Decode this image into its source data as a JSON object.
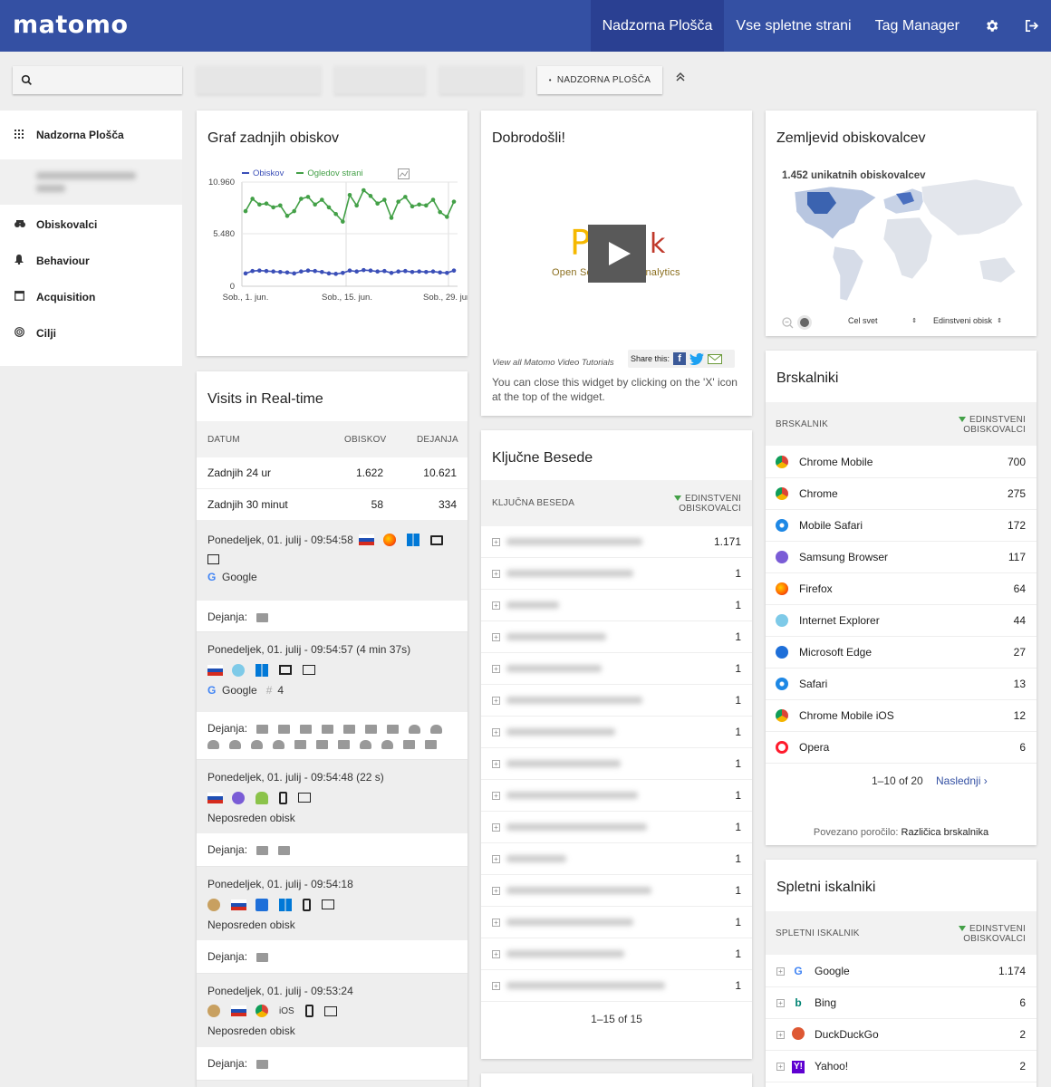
{
  "app": {
    "logo": "matomo"
  },
  "topnav": {
    "dashboard": "Nadzorna Plošča",
    "all_sites": "Vse spletne strani",
    "tag_manager": "Tag Manager"
  },
  "toolbar": {
    "dashboard_button": "NADZORNA PLOŠČA"
  },
  "sidebar": {
    "items": [
      {
        "label": "Nadzorna Plošča",
        "icon": "grid-icon"
      },
      {
        "label": "Obiskovalci",
        "icon": "binoculars-icon"
      },
      {
        "label": "Behaviour",
        "icon": "bell-icon"
      },
      {
        "label": "Acquisition",
        "icon": "window-icon"
      },
      {
        "label": "Cilji",
        "icon": "target-icon"
      }
    ]
  },
  "graph": {
    "title": "Graf zadnjih obiskov",
    "legend": [
      "Obiskov",
      "Ogledov strani"
    ],
    "colors": {
      "visits": "#3b4fb8",
      "pageviews": "#43a047"
    },
    "y_ticks": [
      "10.960",
      "5.480",
      "0"
    ],
    "x_ticks": [
      "Sob., 1. jun.",
      "Sob., 15. jun.",
      "Sob., 29. jun."
    ]
  },
  "chart_data": {
    "type": "line",
    "title": "Graf zadnjih obiskov",
    "ylim": [
      0,
      10960
    ],
    "x": [
      1,
      2,
      3,
      4,
      5,
      6,
      7,
      8,
      9,
      10,
      11,
      12,
      13,
      14,
      15,
      16,
      17,
      18,
      19,
      20,
      21,
      22,
      23,
      24,
      25,
      26,
      27,
      28,
      29,
      30,
      31
    ],
    "series": [
      {
        "name": "Ogledov strani",
        "values": [
          7900,
          9200,
          8600,
          8700,
          8300,
          8500,
          7400,
          7900,
          9200,
          9400,
          8600,
          9100,
          8300,
          7600,
          6800,
          9600,
          8500,
          10100,
          9500,
          8700,
          9100,
          7200,
          8900,
          9400,
          8400,
          8600,
          8500,
          9100,
          7800,
          7300,
          8900
        ]
      },
      {
        "name": "Obiskov",
        "values": [
          1350,
          1600,
          1650,
          1600,
          1550,
          1500,
          1450,
          1350,
          1550,
          1650,
          1600,
          1500,
          1350,
          1300,
          1400,
          1650,
          1550,
          1700,
          1650,
          1550,
          1600,
          1400,
          1550,
          1600,
          1500,
          1550,
          1500,
          1550,
          1450,
          1400,
          1650
        ]
      }
    ]
  },
  "welcome": {
    "title": "Dobrodošli!",
    "video_text": "Open Source Web Analytics",
    "tutorials": "View all Matomo Video Tutorials",
    "share": "Share this:",
    "note": "You can close this widget by clicking on the 'X' icon at the top of the widget."
  },
  "map": {
    "title": "Zemljevid obiskovalcev",
    "summary": "1.452 unikatnih obiskovalcev",
    "region": "Cel svet",
    "metric": "Edinstveni obisk"
  },
  "realtime": {
    "title": "Visits in Real-time",
    "headers": [
      "DATUM",
      "OBISKOV",
      "DEJANJA"
    ],
    "rows": [
      {
        "label": "Zadnjih 24 ur",
        "visits": "1.622",
        "actions": "10.621"
      },
      {
        "label": "Zadnjih 30 minut",
        "visits": "58",
        "actions": "334"
      }
    ],
    "visits": [
      {
        "time": "Ponedeljek, 01. julij - 09:54:58",
        "ref": "Google",
        "actions_label": "Dejanja:"
      },
      {
        "time": "Ponedeljek, 01. julij - 09:54:57 (4 min 37s)",
        "ref": "Google",
        "kw": "4",
        "actions_label": "Dejanja:"
      },
      {
        "time": "Ponedeljek, 01. julij - 09:54:48 (22 s)",
        "ref": "Neposreden obisk",
        "actions_label": "Dejanja:"
      },
      {
        "time": "Ponedeljek, 01. julij - 09:54:18",
        "ref": "Neposreden obisk",
        "actions_label": "Dejanja:"
      },
      {
        "time": "Ponedeljek, 01. julij - 09:53:24",
        "ref": "Neposreden obisk",
        "os": "iOS",
        "actions_label": "Dejanja:"
      }
    ]
  },
  "keywords": {
    "title": "Ključne Besede",
    "col_keyword": "KLJUČNA BESEDA",
    "col_metric_1": "EDINSTVENI",
    "col_metric_2": "OBISKOVALCI",
    "values": [
      "1.171",
      "1",
      "1",
      "1",
      "1",
      "1",
      "1",
      "1",
      "1",
      "1",
      "1",
      "1",
      "1",
      "1",
      "1"
    ],
    "pagination": "1–15 of 15"
  },
  "browsers": {
    "title": "Brskalniki",
    "col_name": "BRSKALNIK",
    "col_metric_1": "EDINSTVENI",
    "col_metric_2": "OBISKOVALCI",
    "rows": [
      {
        "name": "Chrome Mobile",
        "value": "700",
        "icon": "chrome-icon"
      },
      {
        "name": "Chrome",
        "value": "275",
        "icon": "chrome-icon"
      },
      {
        "name": "Mobile Safari",
        "value": "172",
        "icon": "safari-icon"
      },
      {
        "name": "Samsung Browser",
        "value": "117",
        "icon": "samsung-icon"
      },
      {
        "name": "Firefox",
        "value": "64",
        "icon": "firefox-icon"
      },
      {
        "name": "Internet Explorer",
        "value": "44",
        "icon": "ie-icon"
      },
      {
        "name": "Microsoft Edge",
        "value": "27",
        "icon": "edge-icon"
      },
      {
        "name": "Safari",
        "value": "13",
        "icon": "safari-icon"
      },
      {
        "name": "Chrome Mobile iOS",
        "value": "12",
        "icon": "chrome-icon"
      },
      {
        "name": "Opera",
        "value": "6",
        "icon": "opera-icon"
      }
    ],
    "pagination": "1–10 of 20",
    "next": "Naslednji ›",
    "related_label": "Povezano poročilo:",
    "related_link": "Različica brskalnika"
  },
  "search_engines": {
    "title": "Spletni iskalniki",
    "col_name": "SPLETNI ISKALNIK",
    "col_metric_1": "EDINSTVENI",
    "col_metric_2": "OBISKOVALCI",
    "rows": [
      {
        "name": "Google",
        "value": "1.174"
      },
      {
        "name": "Bing",
        "value": "6"
      },
      {
        "name": "DuckDuckGo",
        "value": "2"
      },
      {
        "name": "Yahoo!",
        "value": "2"
      }
    ]
  }
}
